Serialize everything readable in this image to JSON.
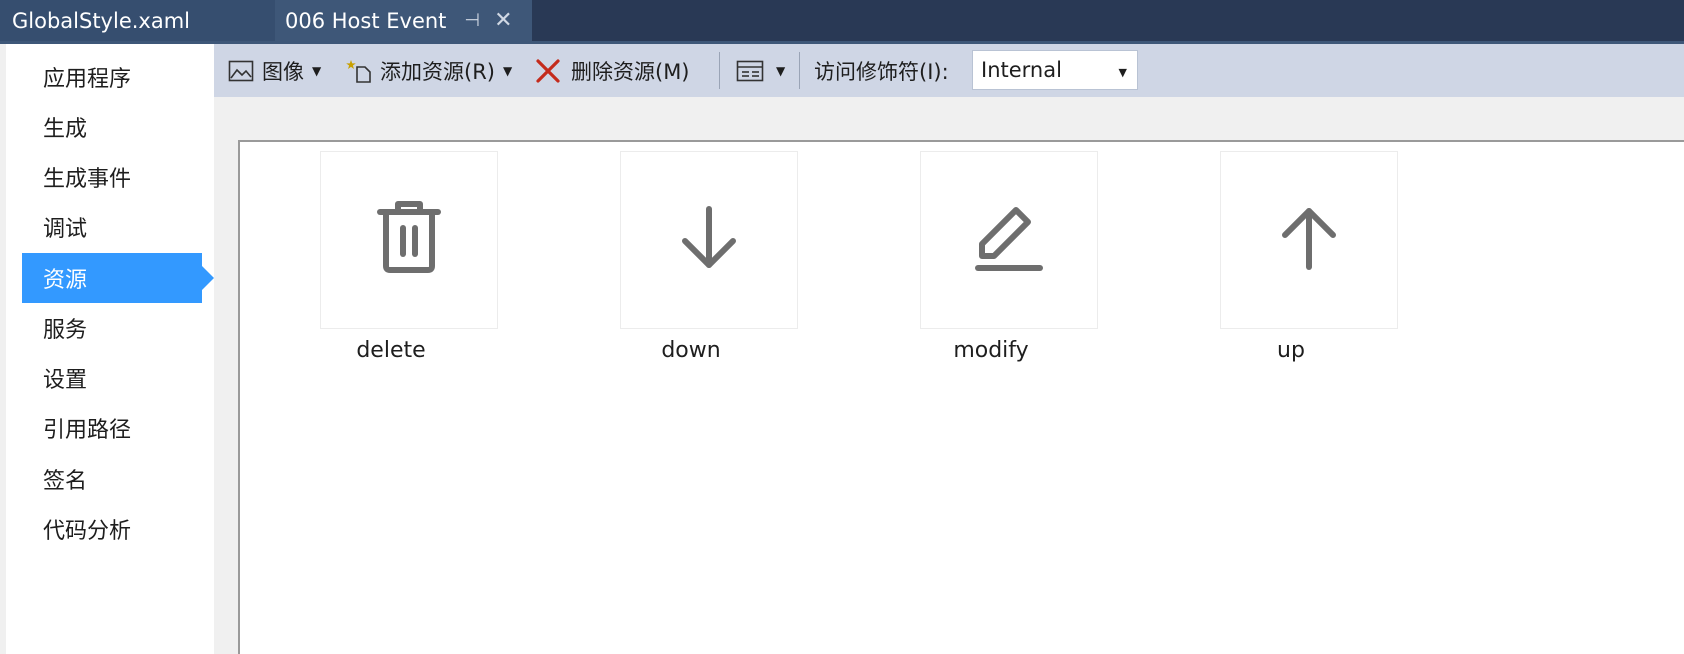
{
  "tabs": [
    {
      "label": "GlobalStyle.xaml"
    },
    {
      "label": "006 Host Event",
      "pin": "⊣",
      "close": "✕"
    }
  ],
  "sidebar": {
    "items": [
      {
        "label": "应用程序"
      },
      {
        "label": "生成"
      },
      {
        "label": "生成事件"
      },
      {
        "label": "调试"
      },
      {
        "label": "资源",
        "selected": true
      },
      {
        "label": "服务"
      },
      {
        "label": "设置"
      },
      {
        "label": "引用路径"
      },
      {
        "label": "签名"
      },
      {
        "label": "代码分析"
      }
    ]
  },
  "toolbar": {
    "image_label": "图像",
    "add_resource_label": "添加资源(R)",
    "delete_resource_label": "删除资源(M)",
    "access_modifier_label": "访问修饰符(I):",
    "access_modifier_value": "Internal"
  },
  "resources": [
    {
      "name": "delete",
      "icon": "trash-icon"
    },
    {
      "name": "down",
      "icon": "arrow-down-icon"
    },
    {
      "name": "modify",
      "icon": "edit-icon"
    },
    {
      "name": "up",
      "icon": "arrow-up-icon"
    }
  ],
  "colors": {
    "tabbar": "#293955",
    "selected_nav": "#3399ff",
    "toolbar": "#cfd6e5",
    "icon_gray": "#6e6e6e",
    "delete_red": "#c42b1c"
  }
}
